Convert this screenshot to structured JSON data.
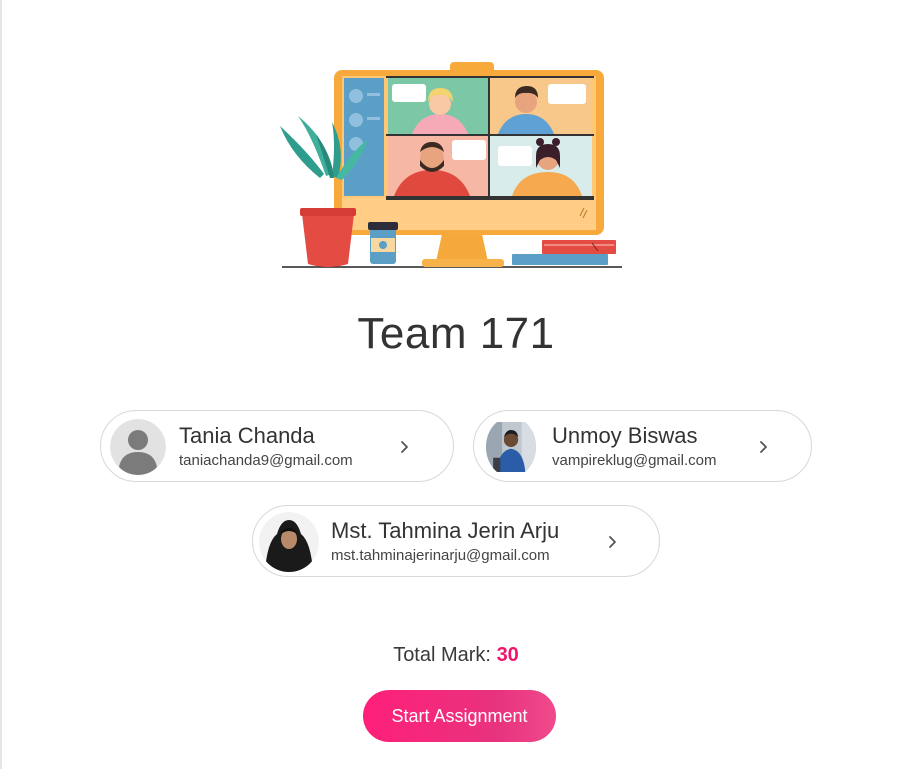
{
  "team": {
    "title": "Team 171"
  },
  "members": [
    {
      "name": "Tania Chanda",
      "email": "taniachanda9@gmail.com",
      "avatar": "default-avatar-icon"
    },
    {
      "name": "Unmoy Biswas",
      "email": "vampireklug@gmail.com",
      "avatar": "profile-photo"
    },
    {
      "name": "Mst. Tahmina Jerin Arju",
      "email": "mst.tahminajerinarju@gmail.com",
      "avatar": "profile-photo"
    }
  ],
  "total_mark": {
    "label": "Total Mark:",
    "value": "30"
  },
  "actions": {
    "start_label": "Start Assignment"
  },
  "colors": {
    "accent": "#f0166d",
    "button": "#ff1f7a",
    "card_border": "#d8d8d8"
  }
}
